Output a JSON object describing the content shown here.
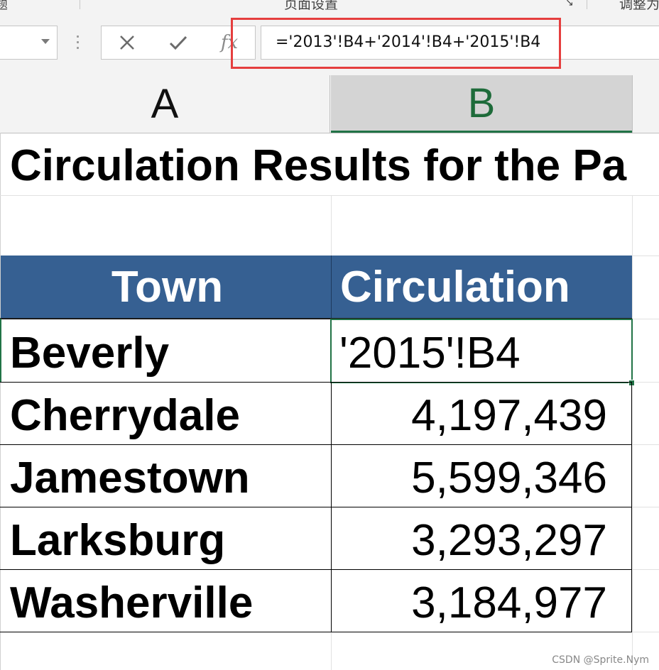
{
  "formula_bar": {
    "formula": "='2013'!B4+'2014'!B4+'2015'!B4",
    "cancel_glyph": "✕",
    "enter_glyph": "✓",
    "fx_glyph": "fx"
  },
  "columns": [
    {
      "label": "A",
      "selected": false
    },
    {
      "label": "B",
      "selected": true
    }
  ],
  "sheet": {
    "title": "Circulation Results for the Pa",
    "table_headers": {
      "town": "Town",
      "circulation": "Circulation"
    },
    "rows": [
      {
        "town": "Beverly",
        "circulation": "'2015'!B4",
        "editing": true
      },
      {
        "town": "Cherrydale",
        "circulation": "4,197,439"
      },
      {
        "town": "Jamestown",
        "circulation": "5,599,346"
      },
      {
        "town": "Larksburg",
        "circulation": "3,293,297"
      },
      {
        "town": "Washerville",
        "circulation": "3,184,977"
      }
    ]
  },
  "watermark": "CSDN @Sprite.Nym",
  "colors": {
    "header_fill": "#366092",
    "selection": "#217346",
    "highlight": "#e53e3e"
  }
}
